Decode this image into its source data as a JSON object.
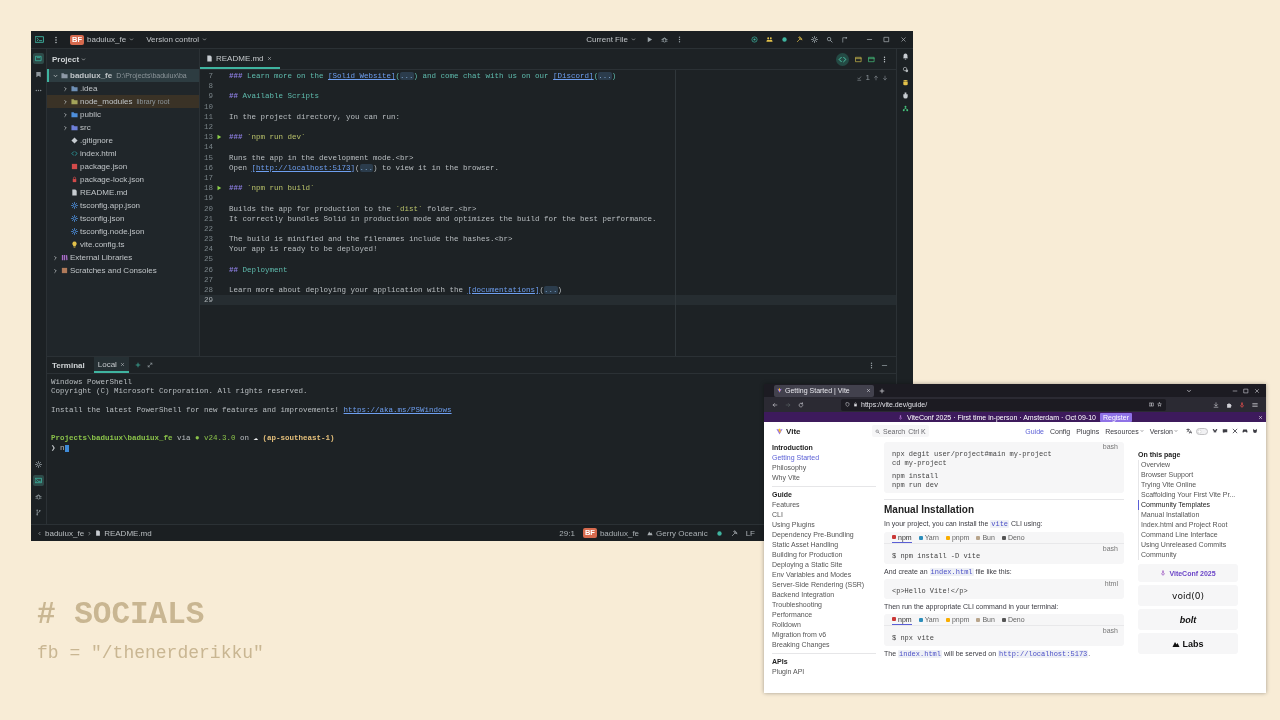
{
  "ide": {
    "titlebar": {
      "project_badge": "BF",
      "project": "baduiux_fe",
      "vcs": "Version control",
      "run_config": "Current File"
    },
    "tool_stripe_top": [
      {
        "selected": true
      },
      {
        "selected": false
      },
      {
        "selected": false
      }
    ],
    "tool_stripe_bottom": [
      {
        "selected": false
      },
      {
        "selected": true
      },
      {
        "selected": false
      },
      {
        "selected": false
      }
    ],
    "project_panel": {
      "title": "Project",
      "tree": [
        {
          "name": "baduiux_fe",
          "hint": "D:\\Projects\\baduiux\\ba",
          "kind": "root",
          "expanded": true,
          "selected": true,
          "children": [
            {
              "name": ".idea",
              "kind": "config",
              "expanded": false,
              "selected": false
            },
            {
              "name": "node_modules",
              "hint": "library root",
              "kind": "library",
              "expanded": false,
              "selected": false
            },
            {
              "name": "public",
              "kind": "folder",
              "expanded": false,
              "selected": false
            },
            {
              "name": "src",
              "kind": "source",
              "expanded": false,
              "selected": false
            },
            {
              "name": ".gitignore",
              "kind": "gitignore",
              "selected": false
            },
            {
              "name": "index.html",
              "kind": "html",
              "selected": false
            },
            {
              "name": "package.json",
              "kind": "npm",
              "selected": false
            },
            {
              "name": "package-lock.json",
              "kind": "lock",
              "selected": false
            },
            {
              "name": "README.md",
              "kind": "markdown",
              "selected": false
            },
            {
              "name": "tsconfig.app.json",
              "kind": "tsconfig",
              "selected": false
            },
            {
              "name": "tsconfig.json",
              "kind": "tsconfig",
              "selected": false
            },
            {
              "name": "tsconfig.node.json",
              "kind": "tsconfig",
              "selected": false
            },
            {
              "name": "vite.config.ts",
              "kind": "vite",
              "selected": false
            }
          ]
        },
        {
          "name": "External Libraries",
          "kind": "libraries",
          "expanded": false,
          "selected": false
        },
        {
          "name": "Scratches and Consoles",
          "kind": "scratches",
          "expanded": false,
          "selected": false
        }
      ]
    },
    "editor": {
      "tab": {
        "label": "README.md",
        "selected": true
      },
      "inspections": "1",
      "lines": [
        {
          "number": "7",
          "run": false,
          "current": false,
          "segments": [
            {
              "kind": "mark",
              "text": "###"
            },
            {
              "kind": "heading",
              "text": " Learn more on the "
            },
            {
              "kind": "link",
              "text": "[Solid Website]"
            },
            {
              "kind": "heading",
              "text": "("
            },
            {
              "kind": "fold",
              "text": "..."
            },
            {
              "kind": "heading",
              "text": ") and come chat with us on our "
            },
            {
              "kind": "link",
              "text": "[Discord]"
            },
            {
              "kind": "heading",
              "text": "("
            },
            {
              "kind": "fold",
              "text": "..."
            },
            {
              "kind": "heading",
              "text": ")"
            }
          ]
        },
        {
          "number": "8",
          "run": false,
          "current": false
        },
        {
          "number": "9",
          "run": false,
          "current": false,
          "segments": [
            {
              "kind": "mark",
              "text": "##"
            },
            {
              "kind": "heading",
              "text": " Available Scripts"
            }
          ]
        },
        {
          "number": "10",
          "run": false,
          "current": false
        },
        {
          "number": "11",
          "run": false,
          "current": false,
          "segments": [
            {
              "kind": "text",
              "text": "In the project directory, you can run:"
            }
          ]
        },
        {
          "number": "12",
          "run": false,
          "current": false
        },
        {
          "number": "13",
          "run": true,
          "current": false,
          "segments": [
            {
              "kind": "mark",
              "text": "###"
            },
            {
              "kind": "code",
              "text": " `npm run dev`"
            }
          ]
        },
        {
          "number": "14",
          "run": false,
          "current": false
        },
        {
          "number": "15",
          "run": false,
          "current": false,
          "segments": [
            {
              "kind": "text",
              "text": "Runs the app in the development mode.<br>"
            }
          ]
        },
        {
          "number": "16",
          "run": false,
          "current": false,
          "segments": [
            {
              "kind": "text",
              "text": "Open "
            },
            {
              "kind": "link",
              "text": "[http://localhost:5173]"
            },
            {
              "kind": "text",
              "text": "("
            },
            {
              "kind": "fold",
              "text": "..."
            },
            {
              "kind": "text",
              "text": ") to view it in the browser."
            }
          ]
        },
        {
          "number": "17",
          "run": false,
          "current": false
        },
        {
          "number": "18",
          "run": true,
          "current": false,
          "segments": [
            {
              "kind": "mark",
              "text": "###"
            },
            {
              "kind": "code",
              "text": " `npm run build`"
            }
          ]
        },
        {
          "number": "19",
          "run": false,
          "current": false
        },
        {
          "number": "20",
          "run": false,
          "current": false,
          "segments": [
            {
              "kind": "text",
              "text": "Builds the app for production to the "
            },
            {
              "kind": "code",
              "text": "`dist`"
            },
            {
              "kind": "text",
              "text": " folder.<br>"
            }
          ]
        },
        {
          "number": "21",
          "run": false,
          "current": false,
          "segments": [
            {
              "kind": "text",
              "text": "It correctly bundles Solid in production mode and optimizes the build for the best performance."
            }
          ]
        },
        {
          "number": "22",
          "run": false,
          "current": false
        },
        {
          "number": "23",
          "run": false,
          "current": false,
          "segments": [
            {
              "kind": "text",
              "text": "The build is minified and the filenames include the hashes.<br>"
            }
          ]
        },
        {
          "number": "24",
          "run": false,
          "current": false,
          "segments": [
            {
              "kind": "text",
              "text": "Your app is ready to be deployed!"
            }
          ]
        },
        {
          "number": "25",
          "run": false,
          "current": false
        },
        {
          "number": "26",
          "run": false,
          "current": false,
          "segments": [
            {
              "kind": "mark",
              "text": "##"
            },
            {
              "kind": "heading",
              "text": " Deployment"
            }
          ]
        },
        {
          "number": "27",
          "run": false,
          "current": false
        },
        {
          "number": "28",
          "run": false,
          "current": false,
          "segments": [
            {
              "kind": "text",
              "text": "Learn more about deploying your application with the "
            },
            {
              "kind": "link",
              "text": "[documentations]"
            },
            {
              "kind": "text",
              "text": "("
            },
            {
              "kind": "fold",
              "text": "..."
            },
            {
              "kind": "text",
              "text": ")"
            }
          ]
        },
        {
          "number": "29",
          "run": false,
          "current": true
        }
      ]
    },
    "terminal": {
      "title": "Terminal",
      "tabs": [
        {
          "label": "Local",
          "selected": true
        }
      ],
      "lines": [
        {
          "kind": "output",
          "cursor": false,
          "segments": [
            {
              "kind": "text",
              "text": "Windows PowerShell"
            }
          ]
        },
        {
          "kind": "output",
          "cursor": false,
          "segments": [
            {
              "kind": "text",
              "text": "Copyright (C) Microsoft Corporation. All rights reserved."
            }
          ]
        },
        {
          "kind": "blank",
          "cursor": false
        },
        {
          "kind": "output",
          "cursor": false,
          "segments": [
            {
              "kind": "text",
              "text": "Install the latest PowerShell for new features and improvements! "
            },
            {
              "kind": "link",
              "text": "https://aka.ms/PSWindows"
            }
          ]
        },
        {
          "kind": "blank",
          "cursor": false
        },
        {
          "kind": "blank",
          "cursor": false
        },
        {
          "kind": "output",
          "cursor": false,
          "segments": [
            {
              "kind": "path",
              "text": "Projects\\baduiux\\baduiux_fe"
            },
            {
              "kind": "text",
              "text": " via "
            },
            {
              "kind": "version",
              "text": "● v24.3.0"
            },
            {
              "kind": "text",
              "text": " on "
            },
            {
              "kind": "cloud",
              "text": "☁"
            },
            {
              "kind": "region",
              "text": " (ap-southeast-1)"
            }
          ]
        },
        {
          "kind": "input",
          "cursor": true,
          "segments": [
            {
              "kind": "prompt",
              "text": "❯ "
            },
            {
              "kind": "text",
              "text": "n"
            }
          ]
        }
      ]
    },
    "status_bar": {
      "breadcrumb": [
        "baduiux_fe",
        "README.md"
      ],
      "position": "29:1",
      "project_badge": "BF",
      "project": "baduiux_fe",
      "theme": "Gerry Oceanic",
      "line_separator": "LF"
    }
  },
  "browser": {
    "tab": {
      "title": "Getting Started | Vite",
      "selected": true
    },
    "url": "https://vite.dev/guide/",
    "banner": {
      "text": "ViteConf 2025 · First time in-person · Amsterdam · Oct 09-10",
      "button": "Register"
    },
    "site": {
      "logo": "Vite",
      "dark_mode": false,
      "search": {
        "placeholder": "Search",
        "shortcut": "Ctrl K"
      },
      "nav": [
        {
          "label": "Guide",
          "selected": true,
          "dropdown": false
        },
        {
          "label": "Config",
          "selected": false,
          "dropdown": false
        },
        {
          "label": "Plugins",
          "selected": false,
          "dropdown": false
        },
        {
          "label": "Resources",
          "selected": false,
          "dropdown": true
        },
        {
          "label": "Version",
          "selected": false,
          "dropdown": true
        }
      ],
      "sidebar": [
        {
          "title": "Introduction",
          "items": [
            {
              "label": "Getting Started",
              "selected": true
            },
            {
              "label": "Philosophy",
              "selected": false
            },
            {
              "label": "Why Vite",
              "selected": false
            }
          ]
        },
        {
          "title": "Guide",
          "items": [
            {
              "label": "Features",
              "selected": false
            },
            {
              "label": "CLI",
              "selected": false
            },
            {
              "label": "Using Plugins",
              "selected": false
            },
            {
              "label": "Dependency Pre-Bundling",
              "selected": false
            },
            {
              "label": "Static Asset Handling",
              "selected": false
            },
            {
              "label": "Building for Production",
              "selected": false
            },
            {
              "label": "Deploying a Static Site",
              "selected": false
            },
            {
              "label": "Env Variables and Modes",
              "selected": false
            },
            {
              "label": "Server-Side Rendering (SSR)",
              "selected": false
            },
            {
              "label": "Backend Integration",
              "selected": false
            },
            {
              "label": "Troubleshooting",
              "selected": false
            },
            {
              "label": "Performance",
              "selected": false
            },
            {
              "label": "Rolldown",
              "selected": false
            },
            {
              "label": "Migration from v6",
              "selected": false
            },
            {
              "label": "Breaking Changes",
              "selected": false
            }
          ]
        },
        {
          "title": "APIs",
          "items": [
            {
              "label": "Plugin API",
              "selected": false
            }
          ]
        }
      ],
      "content": [
        {
          "kind": "code",
          "lang": "bash",
          "groups": [
            [
              "npx degit user/project#main my-project",
              "cd my-project"
            ],
            [
              "npm install",
              "npm run dev"
            ]
          ]
        },
        {
          "kind": "divider"
        },
        {
          "kind": "heading",
          "text": "Manual Installation"
        },
        {
          "kind": "paragraph",
          "segments": [
            {
              "kind": "text",
              "text": "In your project, you can install the "
            },
            {
              "kind": "code",
              "text": "vite"
            },
            {
              "kind": "text",
              "text": " CLI using:"
            }
          ]
        },
        {
          "kind": "code-group",
          "lang": "bash",
          "tabs": [
            {
              "label": "npm",
              "selected": true,
              "color": "#cb3837"
            },
            {
              "label": "Yarn",
              "selected": false,
              "color": "#2c8ebb"
            },
            {
              "label": "pnpm",
              "selected": false,
              "color": "#f9ad00"
            },
            {
              "label": "Bun",
              "selected": false,
              "color": "#b8a58c"
            },
            {
              "label": "Deno",
              "selected": false,
              "color": "#555555"
            }
          ],
          "groups": [
            [
              "$ npm install -D vite"
            ]
          ]
        },
        {
          "kind": "paragraph",
          "segments": [
            {
              "kind": "text",
              "text": "And create an "
            },
            {
              "kind": "code",
              "text": "index.html"
            },
            {
              "kind": "text",
              "text": " file like this:"
            }
          ]
        },
        {
          "kind": "code",
          "lang": "html",
          "groups": [
            [
              "<p>Hello Vite!</p>"
            ]
          ]
        },
        {
          "kind": "paragraph",
          "segments": [
            {
              "kind": "text",
              "text": "Then run the appropriate CLI command in your terminal:"
            }
          ]
        },
        {
          "kind": "code-group",
          "lang": "bash",
          "tabs": [
            {
              "label": "npm",
              "selected": true,
              "color": "#cb3837"
            },
            {
              "label": "Yarn",
              "selected": false,
              "color": "#2c8ebb"
            },
            {
              "label": "pnpm",
              "selected": false,
              "color": "#f9ad00"
            },
            {
              "label": "Bun",
              "selected": false,
              "color": "#b8a58c"
            },
            {
              "label": "Deno",
              "selected": false,
              "color": "#555555"
            }
          ],
          "groups": [
            [
              "$ npx vite"
            ]
          ]
        },
        {
          "kind": "paragraph",
          "segments": [
            {
              "kind": "text",
              "text": "The "
            },
            {
              "kind": "code",
              "text": "index.html"
            },
            {
              "kind": "text",
              "text": " will be served on "
            },
            {
              "kind": "code",
              "text": "http://localhost:5173"
            },
            {
              "kind": "text",
              "text": "."
            }
          ]
        }
      ],
      "aside": {
        "toc_title": "On this page",
        "toc": [
          {
            "label": "Overview",
            "selected": false
          },
          {
            "label": "Browser Support",
            "selected": false
          },
          {
            "label": "Trying Vite Online",
            "selected": false
          },
          {
            "label": "Scaffolding Your First Vite Pr...",
            "selected": false
          },
          {
            "label": "Community Templates",
            "selected": true
          },
          {
            "label": "Manual Installation",
            "selected": false
          },
          {
            "label": "Index.html and Project Root",
            "selected": false
          },
          {
            "label": "Command Line Interface",
            "selected": false
          },
          {
            "label": "Using Unreleased Commits",
            "selected": false
          },
          {
            "label": "Community",
            "selected": false
          }
        ],
        "promo": "ViteConf 2025",
        "sponsors": [
          {
            "kind": "void",
            "text": "void(0)"
          },
          {
            "kind": "bolt",
            "text": "bolt"
          },
          {
            "kind": "labs",
            "text": "Labs"
          }
        ]
      }
    }
  },
  "desktop": {
    "heading": "# SOCIALS",
    "subtext": "fb = \"/thenerderikku\""
  }
}
